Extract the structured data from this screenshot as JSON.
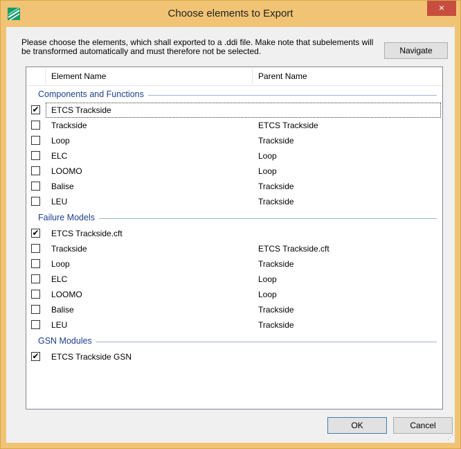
{
  "window": {
    "title": "Choose elements to Export",
    "close_label": "×",
    "app_icon": "app-logo-icon"
  },
  "instructions": "Please choose the elements, which shall exported to a .ddi file. Make note that subelements will be transformed automatically and must therefore not be selected.",
  "buttons": {
    "navigate": "Navigate",
    "ok": "OK",
    "cancel": "Cancel"
  },
  "columns": {
    "element": "Element Name",
    "parent": "Parent Name"
  },
  "groups": [
    {
      "label": "Components and Functions",
      "rows": [
        {
          "name": "ETCS Trackside",
          "parent": "",
          "checked": true,
          "focused": true
        },
        {
          "name": "Trackside",
          "parent": "ETCS Trackside",
          "checked": false
        },
        {
          "name": "Loop",
          "parent": "Trackside",
          "checked": false
        },
        {
          "name": "ELC",
          "parent": "Loop",
          "checked": false
        },
        {
          "name": "LOOMO",
          "parent": "Loop",
          "checked": false
        },
        {
          "name": "Balise",
          "parent": "Trackside",
          "checked": false
        },
        {
          "name": "LEU",
          "parent": "Trackside",
          "checked": false
        }
      ]
    },
    {
      "label": "Failure Models",
      "rows": [
        {
          "name": "ETCS Trackside.cft",
          "parent": "",
          "checked": true
        },
        {
          "name": "Trackside",
          "parent": "ETCS Trackside.cft",
          "checked": false
        },
        {
          "name": "Loop",
          "parent": "Trackside",
          "checked": false
        },
        {
          "name": "ELC",
          "parent": "Loop",
          "checked": false
        },
        {
          "name": "LOOMO",
          "parent": "Loop",
          "checked": false
        },
        {
          "name": "Balise",
          "parent": "Trackside",
          "checked": false
        },
        {
          "name": "LEU",
          "parent": "Trackside",
          "checked": false
        }
      ]
    },
    {
      "label": "GSN Modules",
      "rows": [
        {
          "name": "ETCS Trackside GSN",
          "parent": "",
          "checked": true
        }
      ]
    }
  ],
  "colors": {
    "titlebar": "#f0c474",
    "close": "#c74e3f",
    "group_text": "#1e3f8f",
    "dialog": "#f0f0f0"
  }
}
